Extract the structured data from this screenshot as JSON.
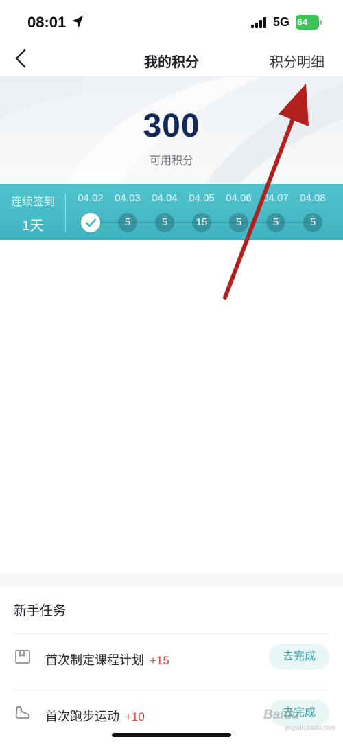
{
  "status_bar": {
    "time": "08:01",
    "network": "5G",
    "battery": "64",
    "icons": [
      "location-arrow-icon",
      "signal-icon",
      "battery-icon"
    ]
  },
  "nav": {
    "back_icon": "chevron-left-icon",
    "title": "我的积分",
    "detail_link": "积分明细"
  },
  "points": {
    "value": "300",
    "label": "可用积分"
  },
  "checkin": {
    "streak_title": "连续签到",
    "streak_days": "1天",
    "days": [
      {
        "date": "04.02",
        "reward": "",
        "signed": true
      },
      {
        "date": "04.03",
        "reward": "5",
        "signed": false
      },
      {
        "date": "04.04",
        "reward": "5",
        "signed": false
      },
      {
        "date": "04.05",
        "reward": "15",
        "signed": false
      },
      {
        "date": "04.06",
        "reward": "5",
        "signed": false
      },
      {
        "date": "04.07",
        "reward": "5",
        "signed": false
      },
      {
        "date": "04.08",
        "reward": "5",
        "signed": false
      }
    ]
  },
  "tasks": {
    "title": "新手任务",
    "items": [
      {
        "name": "首次制定课程计划",
        "points": "+15",
        "button": "去完成",
        "icon": "bookmark-icon"
      },
      {
        "name": "首次跑步运动",
        "points": "+10",
        "button": "去完成",
        "icon": "shoe-icon"
      }
    ]
  },
  "watermark": {
    "text": "Baidu",
    "sub": "jingyan.baidu.com"
  },
  "colors": {
    "accent_teal": "#45b8c3",
    "points_navy": "#15285a",
    "bonus_red": "#e0443e",
    "annotation_arrow": "#b3211e"
  }
}
